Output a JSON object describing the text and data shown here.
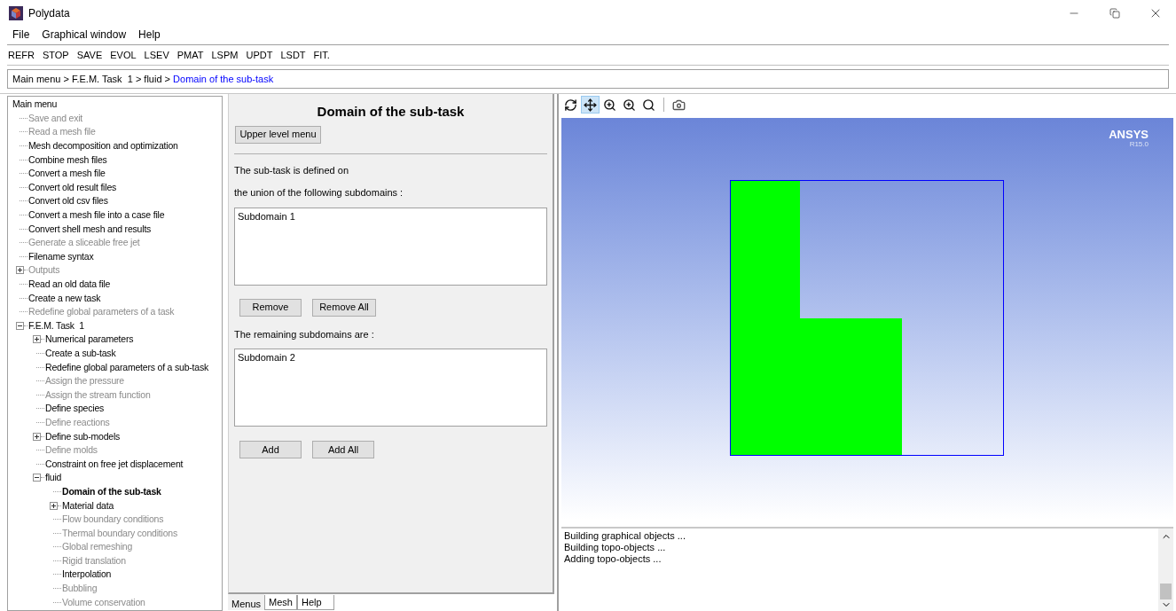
{
  "window": {
    "title": "Polydata"
  },
  "menu": [
    "File",
    "Graphical window",
    "Help"
  ],
  "toolbar": [
    "REFR",
    "STOP",
    "SAVE",
    "EVOL",
    "LSEV",
    "PMAT",
    "LSPM",
    "UPDT",
    "LSDT",
    "FIT."
  ],
  "breadcrumb": {
    "path": "Main menu > F.E.M. Task  1 > fluid > ",
    "current": "Domain of the sub-task"
  },
  "tree": {
    "label": "Main menu",
    "disabled": false,
    "selected": false,
    "children": [
      {
        "label": "Save and exit",
        "disabled": true,
        "selected": false
      },
      {
        "label": "Read a mesh file",
        "disabled": true,
        "selected": false
      },
      {
        "label": "Mesh decomposition and optimization",
        "disabled": false,
        "selected": false
      },
      {
        "label": "Combine mesh files",
        "disabled": false,
        "selected": false
      },
      {
        "label": "Convert a mesh file",
        "disabled": false,
        "selected": false
      },
      {
        "label": "Convert old result files",
        "disabled": false,
        "selected": false
      },
      {
        "label": "Convert old csv files",
        "disabled": false,
        "selected": false
      },
      {
        "label": "Convert a mesh file into a case file",
        "disabled": false,
        "selected": false
      },
      {
        "label": "Convert shell mesh and results",
        "disabled": false,
        "selected": false
      },
      {
        "label": "Generate a sliceable free jet",
        "disabled": true,
        "selected": false
      },
      {
        "label": "Filename syntax",
        "disabled": false,
        "selected": false
      },
      {
        "label": "Outputs",
        "disabled": true,
        "selected": false,
        "expanded": false
      },
      {
        "label": "Read an old data file",
        "disabled": false,
        "selected": false
      },
      {
        "label": "Create a new task",
        "disabled": false,
        "selected": false
      },
      {
        "label": "Redefine global parameters of a task",
        "disabled": true,
        "selected": false
      },
      {
        "label": "F.E.M. Task  1",
        "disabled": false,
        "selected": false,
        "expanded": true,
        "children": [
          {
            "label": "Numerical parameters",
            "disabled": false,
            "selected": false,
            "expanded": false
          },
          {
            "label": "Create a sub-task",
            "disabled": false,
            "selected": false
          },
          {
            "label": "Redefine global parameters of a sub-task",
            "disabled": false,
            "selected": false
          },
          {
            "label": "Assign the pressure",
            "disabled": true,
            "selected": false
          },
          {
            "label": "Assign the stream function",
            "disabled": true,
            "selected": false
          },
          {
            "label": "Define species",
            "disabled": false,
            "selected": false
          },
          {
            "label": "Define reactions",
            "disabled": true,
            "selected": false
          },
          {
            "label": "Define sub-models",
            "disabled": false,
            "selected": false,
            "expanded": false
          },
          {
            "label": "Define molds",
            "disabled": true,
            "selected": false
          },
          {
            "label": "Constraint on free jet displacement",
            "disabled": false,
            "selected": false
          },
          {
            "label": "fluid",
            "disabled": false,
            "selected": false,
            "expanded": true,
            "children": [
              {
                "label": "Domain of the sub-task",
                "disabled": false,
                "selected": true
              },
              {
                "label": "Material data",
                "disabled": false,
                "selected": false,
                "expanded": false
              },
              {
                "label": "Flow boundary conditions",
                "disabled": true,
                "selected": false
              },
              {
                "label": "Thermal boundary conditions",
                "disabled": true,
                "selected": false
              },
              {
                "label": "Global remeshing",
                "disabled": true,
                "selected": false
              },
              {
                "label": "Rigid translation",
                "disabled": true,
                "selected": false
              },
              {
                "label": "Interpolation",
                "disabled": false,
                "selected": false
              },
              {
                "label": "Bubbling",
                "disabled": true,
                "selected": false
              },
              {
                "label": "Volume conservation",
                "disabled": true,
                "selected": false
              }
            ]
          }
        ]
      }
    ]
  },
  "panel": {
    "title": "Domain of the sub-task",
    "upper_button": "Upper level menu",
    "text_1": "The sub-task is defined on",
    "text_2": "the union of the following subdomains :",
    "selected_list": [
      "Subdomain 1"
    ],
    "remove_buttons": [
      "Remove",
      "Remove All"
    ],
    "remaining_label": "The remaining subdomains are :",
    "remaining_list": [
      "Subdomain 2"
    ],
    "add_buttons": [
      "Add",
      "Add All"
    ]
  },
  "bottom_tabs": [
    {
      "label": "Menus",
      "selected": true
    },
    {
      "label": "Mesh",
      "selected": false
    },
    {
      "label": "Help",
      "selected": false
    }
  ],
  "graphics": {
    "tools": [
      {
        "kind": "rotate",
        "selected": false
      },
      {
        "kind": "pan",
        "selected": true
      },
      {
        "kind": "zoom_box",
        "selected": false
      },
      {
        "kind": "zoom",
        "selected": false
      },
      {
        "kind": "zoom_fit",
        "selected": false
      },
      {
        "kind": "snapshot",
        "selected": false
      }
    ],
    "logo": "ANSYS",
    "version": "R15.0"
  },
  "log": [
    "Building graphical objects ...",
    "Building topo-objects ...",
    "Adding topo-objects ..."
  ]
}
